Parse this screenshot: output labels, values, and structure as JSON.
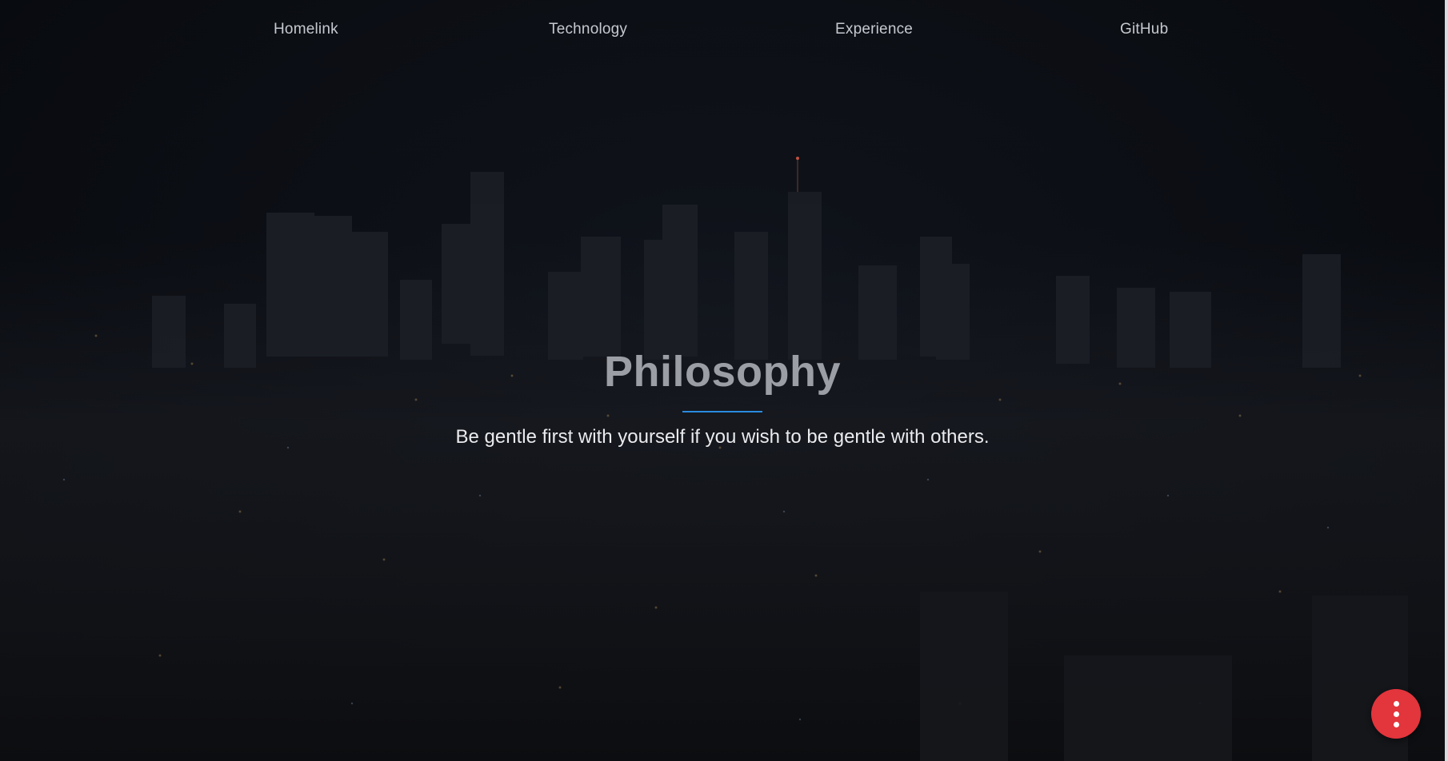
{
  "nav": {
    "items": [
      {
        "label": "Homelink"
      },
      {
        "label": "Technology"
      },
      {
        "label": "Experience"
      },
      {
        "label": "GitHub"
      }
    ]
  },
  "hero": {
    "title": "Philosophy",
    "quote": "Be gentle first with yourself if you wish to be gentle with others."
  },
  "fab": {
    "icon": "more-vertical-icon",
    "color": "#e3353c"
  },
  "colors": {
    "accent_line": "#2a8be0",
    "background": "#0d0f14"
  }
}
